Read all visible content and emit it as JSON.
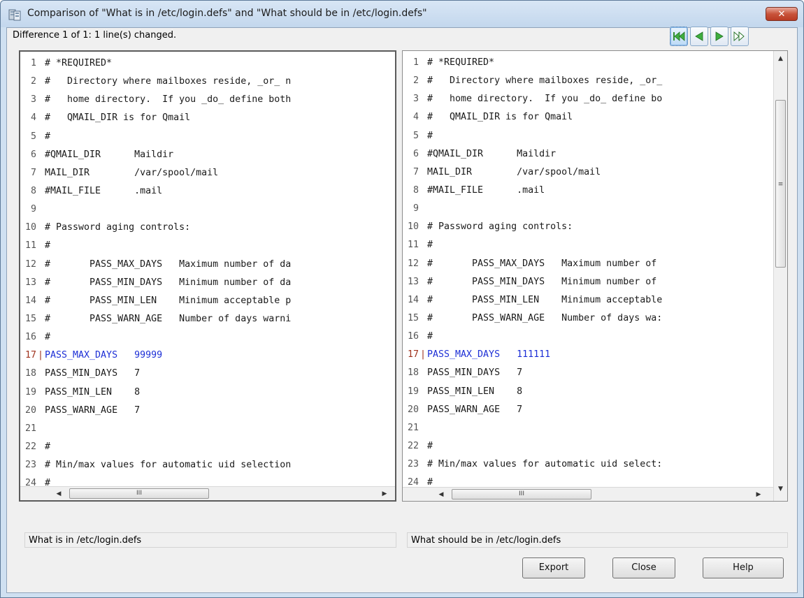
{
  "window": {
    "title": "Comparison of \"What is in /etc/login.defs\" and \"What should be in /etc/login.defs\"",
    "icon": "server-compare-icon",
    "close_label": "✕"
  },
  "status": {
    "text": "Difference 1 of 1:   1 line(s) changed."
  },
  "navigation": [
    {
      "name": "first-difference-button",
      "icon": "first-icon"
    },
    {
      "name": "previous-difference-button",
      "icon": "previous-icon"
    },
    {
      "name": "next-difference-button",
      "icon": "next-icon"
    },
    {
      "name": "last-difference-button",
      "icon": "last-icon"
    }
  ],
  "left_pane": {
    "label": "What is in /etc/login.defs",
    "lines": [
      {
        "n": "1",
        "text": "# *REQUIRED*"
      },
      {
        "n": "2",
        "text": "#   Directory where mailboxes reside, _or_ n"
      },
      {
        "n": "3",
        "text": "#   home directory.  If you _do_ define both"
      },
      {
        "n": "4",
        "text": "#   QMAIL_DIR is for Qmail"
      },
      {
        "n": "5",
        "text": "#"
      },
      {
        "n": "6",
        "text": "#QMAIL_DIR      Maildir"
      },
      {
        "n": "7",
        "text": "MAIL_DIR        /var/spool/mail"
      },
      {
        "n": "8",
        "text": "#MAIL_FILE      .mail"
      },
      {
        "n": "9",
        "text": ""
      },
      {
        "n": "10",
        "text": "# Password aging controls:"
      },
      {
        "n": "11",
        "text": "#"
      },
      {
        "n": "12",
        "text": "#       PASS_MAX_DAYS   Maximum number of da"
      },
      {
        "n": "13",
        "text": "#       PASS_MIN_DAYS   Minimum number of da"
      },
      {
        "n": "14",
        "text": "#       PASS_MIN_LEN    Minimum acceptable p"
      },
      {
        "n": "15",
        "text": "#       PASS_WARN_AGE   Number of days warni"
      },
      {
        "n": "16",
        "text": "#"
      },
      {
        "n": "17",
        "text": "PASS_MAX_DAYS   99999",
        "changed": true
      },
      {
        "n": "18",
        "text": "PASS_MIN_DAYS   7"
      },
      {
        "n": "19",
        "text": "PASS_MIN_LEN    8"
      },
      {
        "n": "20",
        "text": "PASS_WARN_AGE   7"
      },
      {
        "n": "21",
        "text": ""
      },
      {
        "n": "22",
        "text": "#"
      },
      {
        "n": "23",
        "text": "# Min/max values for automatic uid selection"
      },
      {
        "n": "24",
        "text": "#"
      }
    ]
  },
  "right_pane": {
    "label": "What should be in /etc/login.defs",
    "lines": [
      {
        "n": "1",
        "text": "# *REQUIRED*"
      },
      {
        "n": "2",
        "text": "#   Directory where mailboxes reside, _or_"
      },
      {
        "n": "3",
        "text": "#   home directory.  If you _do_ define bo"
      },
      {
        "n": "4",
        "text": "#   QMAIL_DIR is for Qmail"
      },
      {
        "n": "5",
        "text": "#"
      },
      {
        "n": "6",
        "text": "#QMAIL_DIR      Maildir"
      },
      {
        "n": "7",
        "text": "MAIL_DIR        /var/spool/mail"
      },
      {
        "n": "8",
        "text": "#MAIL_FILE      .mail"
      },
      {
        "n": "9",
        "text": ""
      },
      {
        "n": "10",
        "text": "# Password aging controls:"
      },
      {
        "n": "11",
        "text": "#"
      },
      {
        "n": "12",
        "text": "#       PASS_MAX_DAYS   Maximum number of"
      },
      {
        "n": "13",
        "text": "#       PASS_MIN_DAYS   Minimum number of"
      },
      {
        "n": "14",
        "text": "#       PASS_MIN_LEN    Minimum acceptable"
      },
      {
        "n": "15",
        "text": "#       PASS_WARN_AGE   Number of days wa:"
      },
      {
        "n": "16",
        "text": "#"
      },
      {
        "n": "17",
        "text": "PASS_MAX_DAYS   111111",
        "changed": true
      },
      {
        "n": "18",
        "text": "PASS_MIN_DAYS   7"
      },
      {
        "n": "19",
        "text": "PASS_MIN_LEN    8"
      },
      {
        "n": "20",
        "text": "PASS_WARN_AGE   7"
      },
      {
        "n": "21",
        "text": ""
      },
      {
        "n": "22",
        "text": "#"
      },
      {
        "n": "23",
        "text": "# Min/max values for automatic uid select:"
      },
      {
        "n": "24",
        "text": "#"
      }
    ]
  },
  "scrollbar_grip": "III",
  "vscroll_grip": "≡",
  "buttons": {
    "export": "Export",
    "close": "Close",
    "help": "Help"
  },
  "colors": {
    "changed_text": "#1d2fd6",
    "changed_marker": "#a0331e",
    "nav_arrow": "#3fae3f"
  }
}
